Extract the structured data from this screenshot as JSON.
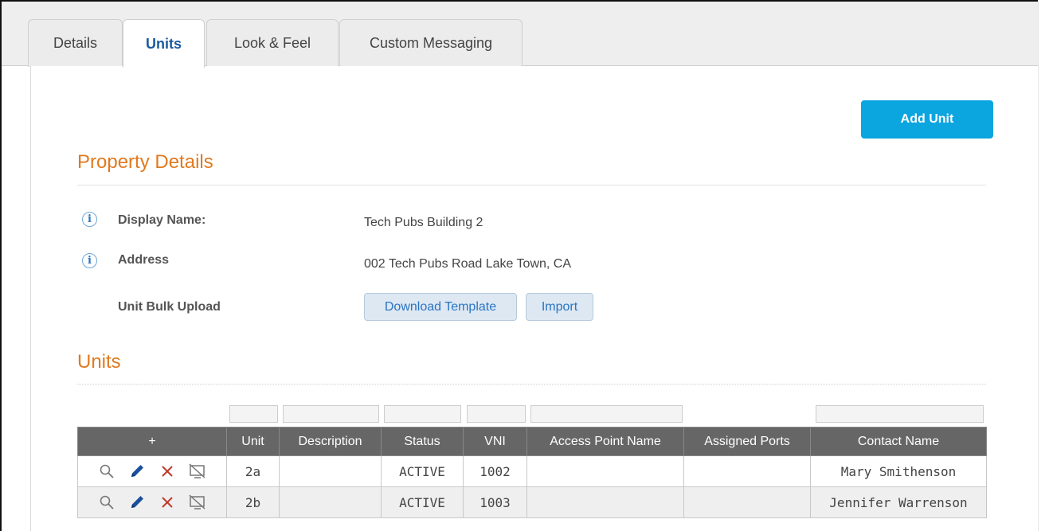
{
  "tabs": [
    {
      "label": "Details",
      "active": false
    },
    {
      "label": "Units",
      "active": true
    },
    {
      "label": "Look & Feel",
      "active": false
    },
    {
      "label": "Custom Messaging",
      "active": false
    }
  ],
  "add_unit_label": "Add Unit",
  "property_details": {
    "title": "Property Details",
    "display_name_label": "Display Name:",
    "display_name_value": "Tech Pubs Building 2",
    "address_label": "Address",
    "address_value": "002 Tech Pubs Road Lake Town, CA",
    "bulk_upload_label": "Unit Bulk Upload",
    "download_template_label": "Download Template",
    "import_label": "Import"
  },
  "units_section": {
    "title": "Units",
    "columns": {
      "add": "+",
      "unit": "Unit",
      "description": "Description",
      "status": "Status",
      "vni": "VNI",
      "access_point_name": "Access Point Name",
      "assigned_ports": "Assigned Ports",
      "contact_name": "Contact Name"
    },
    "rows": [
      {
        "unit": "2a",
        "description": "",
        "status": "ACTIVE",
        "vni": "1002",
        "access_point_name": "",
        "assigned_ports": "",
        "contact_name": "Mary Smithenson"
      },
      {
        "unit": "2b",
        "description": "",
        "status": "ACTIVE",
        "vni": "1003",
        "access_point_name": "",
        "assigned_ports": "",
        "contact_name": "Jennifer Warrenson"
      }
    ]
  },
  "icons": {
    "info": "info-circle-icon",
    "view": "magnifier-icon",
    "edit": "pencil-icon",
    "delete": "x-icon",
    "disable": "crossed-monitor-icon"
  },
  "colors": {
    "accent_blue": "#0ba5e0",
    "section_title_orange": "#e07a1f",
    "active_tab_text": "#1a5aa0",
    "table_header": "#666666",
    "delete_red": "#c0392b",
    "edit_blue": "#1a4f9c"
  }
}
